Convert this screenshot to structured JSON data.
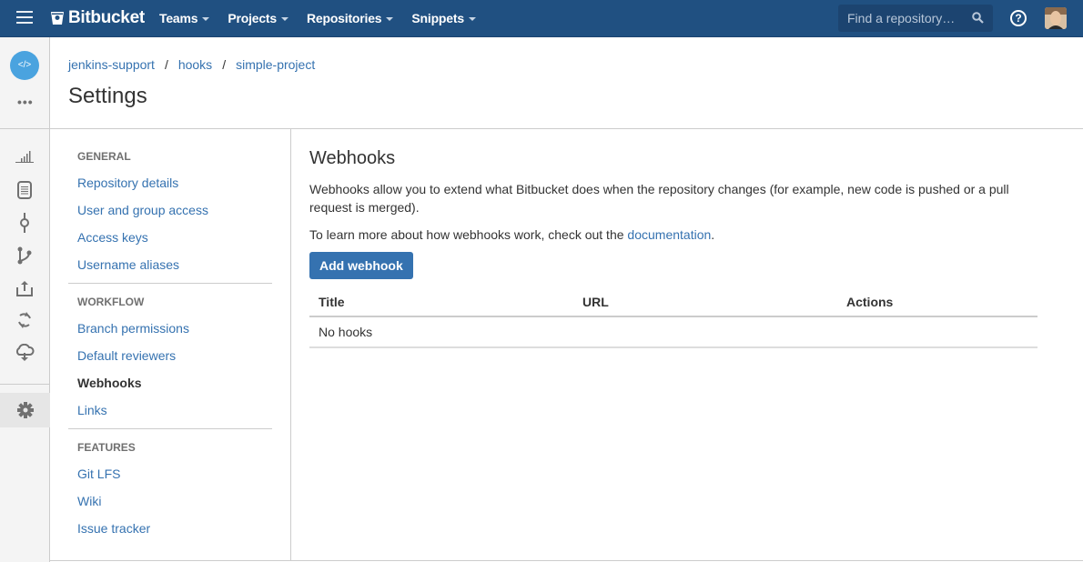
{
  "header": {
    "brand": "Bitbucket",
    "nav": [
      {
        "label": "Teams"
      },
      {
        "label": "Projects"
      },
      {
        "label": "Repositories"
      },
      {
        "label": "Snippets"
      }
    ],
    "search_placeholder": "Find a repository…",
    "help_glyph": "?",
    "icons": {
      "menu": "hamburger-icon",
      "search": "search-icon",
      "help": "help-icon",
      "avatar": "user-avatar"
    }
  },
  "rail": {
    "repo_glyph": "</>",
    "more_glyph": "•••",
    "icons": [
      "overview-icon",
      "source-icon",
      "commits-icon",
      "branches-icon",
      "pull-requests-icon",
      "pipelines-icon",
      "deployments-icon",
      "settings-icon"
    ]
  },
  "breadcrumb": [
    {
      "label": "jenkins-support"
    },
    {
      "label": "hooks"
    },
    {
      "label": "simple-project"
    }
  ],
  "breadcrumb_separator": "/",
  "page_title": "Settings",
  "settings_nav": {
    "sections": [
      {
        "heading": "GENERAL",
        "items": [
          {
            "label": "Repository details",
            "active": false
          },
          {
            "label": "User and group access",
            "active": false
          },
          {
            "label": "Access keys",
            "active": false
          },
          {
            "label": "Username aliases",
            "active": false
          }
        ]
      },
      {
        "heading": "WORKFLOW",
        "items": [
          {
            "label": "Branch permissions",
            "active": false
          },
          {
            "label": "Default reviewers",
            "active": false
          },
          {
            "label": "Webhooks",
            "active": true
          },
          {
            "label": "Links",
            "active": false
          }
        ]
      },
      {
        "heading": "FEATURES",
        "items": [
          {
            "label": "Git LFS",
            "active": false
          },
          {
            "label": "Wiki",
            "active": false
          },
          {
            "label": "Issue tracker",
            "active": false
          }
        ]
      }
    ]
  },
  "main": {
    "title": "Webhooks",
    "description": "Webhooks allow you to extend what Bitbucket does when the repository changes (for example, new code is pushed or a pull request is merged).",
    "learn_more_prefix": "To learn more about how webhooks work, check out the ",
    "learn_more_link": "documentation",
    "learn_more_suffix": ".",
    "add_button": "Add webhook",
    "table": {
      "columns": [
        "Title",
        "URL",
        "Actions"
      ],
      "empty_message": "No hooks"
    }
  },
  "colors": {
    "header_bg": "#205081",
    "link": "#3572b0",
    "button": "#3572b0",
    "repo_avatar": "#4aa3df"
  }
}
